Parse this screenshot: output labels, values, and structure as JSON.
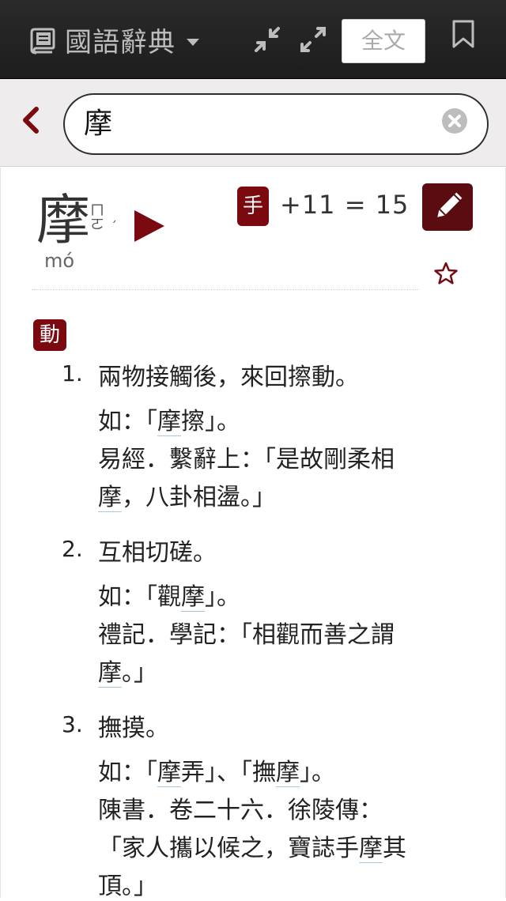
{
  "app": {
    "title": "國語辭典"
  },
  "toolbar": {
    "fulltext_label": "全文"
  },
  "search": {
    "value": "摩"
  },
  "entry": {
    "headword": "摩",
    "zhuyin": "ㄇㄛ",
    "zhuyin_tone": "ˊ",
    "pinyin": "mó",
    "radical": "手",
    "stroke_formula": "+11 = 15",
    "part_of_speech": "動"
  },
  "definitions": [
    {
      "num": "1.",
      "text": "兩物接觸後，來回擦動。",
      "example_pre": "如：「",
      "example_word": "摩",
      "example_post": "擦」。",
      "quote_line1": "易經．繫辭上：「是故剛柔相",
      "quote_line2_word": "摩",
      "quote_line2_rest": "，八卦相盪。」"
    },
    {
      "num": "2.",
      "text": "互相切磋。",
      "example_pre": "如：「觀",
      "example_word": "摩",
      "example_post": "」。",
      "quote_line1": "禮記．學記：「相觀而善之謂",
      "quote_line2_word": "摩",
      "quote_line2_rest": "。」"
    },
    {
      "num": "3.",
      "text": "撫摸。",
      "example_a_pre": "如：「",
      "example_a_word": "摩",
      "example_a_post": "弄」、「撫",
      "example_b_word": "摩",
      "example_b_post": "」。",
      "quote_line1": "陳書．卷二十六．徐陵傳：",
      "quote_line2_pre": "「家人攜以候之，寶誌手",
      "quote_line2_word": "摩",
      "quote_line2_post": "其",
      "quote_line3": "頂。」"
    }
  ],
  "colors": {
    "accent": "#7a0a10",
    "topbar": "#222222",
    "searchbar_bg": "#efeced"
  },
  "icons": [
    "book-icon",
    "compress-icon",
    "expand-icon",
    "bookmark-icon",
    "back-icon",
    "clear-icon",
    "play-icon",
    "edit-icon",
    "star-icon"
  ]
}
